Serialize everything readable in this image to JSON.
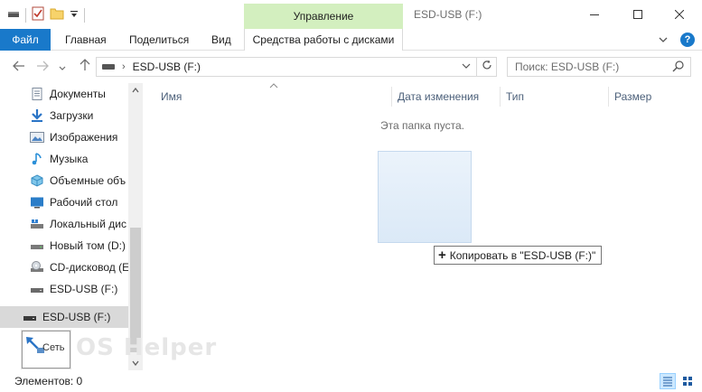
{
  "titlebar": {
    "title": "ESD-USB (F:)",
    "context_tab_group": "Управление"
  },
  "ribbon": {
    "tabs": [
      "Файл",
      "Главная",
      "Поделиться",
      "Вид"
    ],
    "context_tab": "Средства работы с дисками",
    "active_tab_color": "#1979ca",
    "help_label": "?"
  },
  "address": {
    "path": "ESD-USB (F:)"
  },
  "search": {
    "placeholder": "Поиск: ESD-USB (F:)"
  },
  "nav_pane": {
    "items": [
      {
        "label": "Документы",
        "icon": "documents-icon"
      },
      {
        "label": "Загрузки",
        "icon": "downloads-icon"
      },
      {
        "label": "Изображения",
        "icon": "pictures-icon"
      },
      {
        "label": "Музыка",
        "icon": "music-icon"
      },
      {
        "label": "Объемные объ",
        "icon": "3d-objects-icon"
      },
      {
        "label": "Рабочий стол",
        "icon": "desktop-icon"
      },
      {
        "label": "Локальный дис",
        "icon": "local-disk-icon"
      },
      {
        "label": "Новый том (D:)",
        "icon": "drive-icon"
      },
      {
        "label": "CD-дисковод (E",
        "icon": "cd-drive-icon"
      },
      {
        "label": "ESD-USB (F:)",
        "icon": "usb-drive-icon"
      }
    ],
    "selected": {
      "label": "ESD-USB (F:)",
      "icon": "usb-drive-icon"
    }
  },
  "columns": {
    "name": "Имя",
    "date": "Дата изменения",
    "type": "Тип",
    "size": "Размер"
  },
  "content": {
    "empty_text": "Эта папка пуста.",
    "drop_tip": "Копировать в \"ESD-USB (F:)\""
  },
  "drag_overlay": {
    "label": "Сеть"
  },
  "watermark": "OS Helper",
  "status": {
    "items_text": "Элементов: 0"
  }
}
